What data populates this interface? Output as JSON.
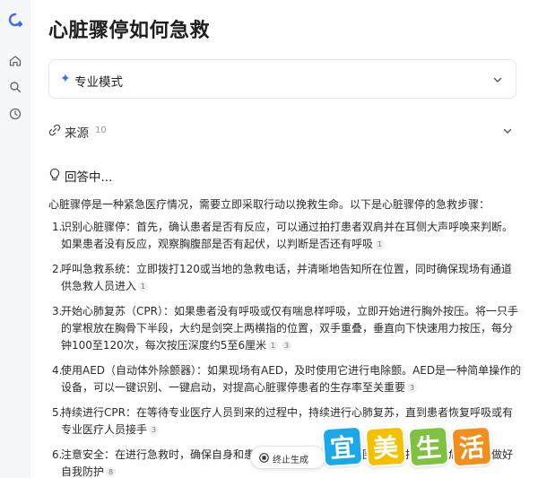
{
  "sidebar": {
    "icons": [
      "app-logo-icon",
      "home-icon",
      "search-icon",
      "history-icon"
    ]
  },
  "page": {
    "title": "心脏骤停如何急救"
  },
  "mode": {
    "label": "专业模式"
  },
  "sources": {
    "label": "来源",
    "count": "10"
  },
  "status": {
    "label": "回答中..."
  },
  "answer": {
    "intro": "心脏骤停是一种紧急医疗情况，需要立即采取行动以挽救生命。以下是心脏骤停的急救步骤：",
    "steps": [
      {
        "num": "1.",
        "text": "识别心脏骤停：首先，确认患者是否有反应，可以通过拍打患者双肩并在耳侧大声呼唤来判断。如果患者没有反应，观察胸腹部是否有起伏，以判断是否还有呼吸",
        "cites": [
          "1"
        ]
      },
      {
        "num": "2.",
        "text": "呼叫急救系统：立即拨打120或当地的急救电话，并清晰地告知所在位置，同时确保现场有通道供急救人员进入",
        "cites": [
          "1"
        ]
      },
      {
        "num": "3.",
        "text": "开始心肺复苏（CPR）：如果患者没有呼吸或仅有喘息样呼吸，立即开始进行胸外按压。将一只手的掌根放在胸骨下半段，大约是剑突上两横指的位置，双手重叠，垂直向下快速用力按压，每分钟100至120次，每次按压深度约5至6厘米",
        "cites": [
          "1",
          "3"
        ]
      },
      {
        "num": "4.",
        "text": "使用AED（自动体外除颤器）：如果现场有AED，及时使用它进行电除颤。AED是一种简单操作的设备，可以一键识别、一键启动，对提高心脏骤停患者的生存率至关重要",
        "cites": [
          "3"
        ]
      },
      {
        "num": "5.",
        "text": "持续进行CPR：在等待专业医疗人员到来的过程中，持续进行心肺复苏，直到患者恢复呼吸或有专业医疗人员接手",
        "cites": [
          "3"
        ]
      },
      {
        "num": "6.",
        "text": "注意安全：在进行急救时，确保自身和患者的安全，快速观察周围环境，排除潜在危险，并做好自我防护",
        "cites": [
          "8"
        ]
      }
    ]
  },
  "controls": {
    "stop_label": "终止生成"
  },
  "watermark": {
    "chars": [
      "宜",
      "美",
      "生",
      "活"
    ]
  },
  "colors": {
    "accent": "#3b6cf6",
    "text": "#2b2b2b"
  }
}
